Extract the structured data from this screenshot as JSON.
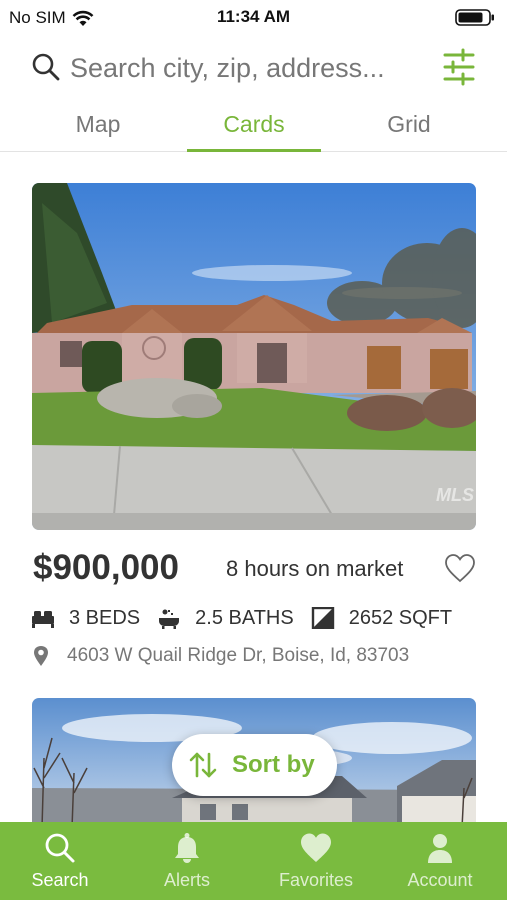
{
  "status_bar": {
    "carrier": "No SIM",
    "time": "11:34 AM"
  },
  "search": {
    "placeholder": "Search city, zip, address..."
  },
  "tabs": [
    {
      "label": "Map",
      "active": false
    },
    {
      "label": "Cards",
      "active": true
    },
    {
      "label": "Grid",
      "active": false
    }
  ],
  "listing": {
    "price": "$900,000",
    "market_time": "8 hours on market",
    "beds": "3 BEDS",
    "baths": "2.5 BATHS",
    "sqft": "2652 SQFT",
    "address": "4603 W Quail Ridge Dr, Boise, Id, 83703",
    "watermark": "MLS"
  },
  "sort": {
    "label": "Sort by"
  },
  "bottom_nav": [
    {
      "label": "Search",
      "icon": "search-icon",
      "active": true
    },
    {
      "label": "Alerts",
      "icon": "bell-icon",
      "active": false
    },
    {
      "label": "Favorites",
      "icon": "heart-icon",
      "active": false
    },
    {
      "label": "Account",
      "icon": "person-icon",
      "active": false
    }
  ],
  "colors": {
    "accent": "#79b63a",
    "nav_background": "#7abb3f"
  }
}
